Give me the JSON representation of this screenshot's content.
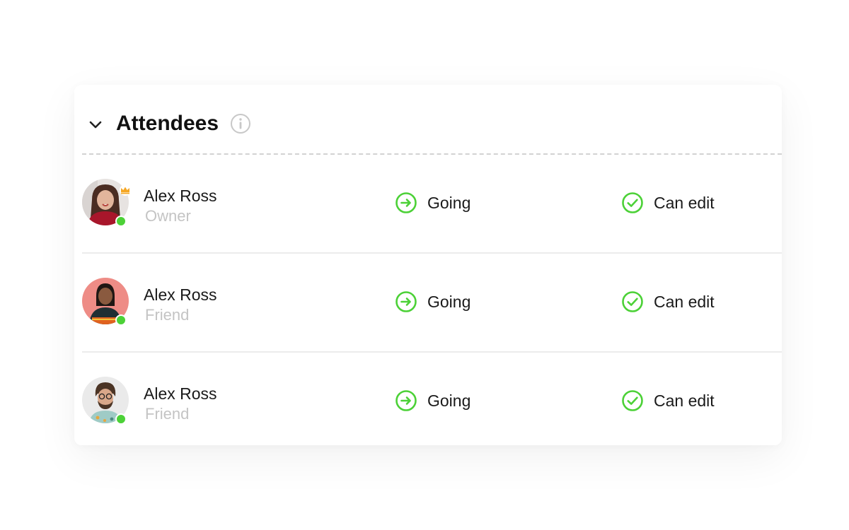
{
  "section": {
    "title": "Attendees",
    "accent_color": "#4cd137",
    "icons": {
      "collapse": "chevron-down-icon",
      "info": "info-icon"
    }
  },
  "attendees": [
    {
      "name": "Alex Ross",
      "role": "Owner",
      "status": "Going",
      "permission": "Can edit",
      "online": true,
      "badge": "crown-icon"
    },
    {
      "name": "Alex Ross",
      "role": "Friend",
      "status": "Going",
      "permission": "Can edit",
      "online": true
    },
    {
      "name": "Alex Ross",
      "role": "Friend",
      "status": "Going",
      "permission": "Can edit",
      "online": true
    }
  ]
}
